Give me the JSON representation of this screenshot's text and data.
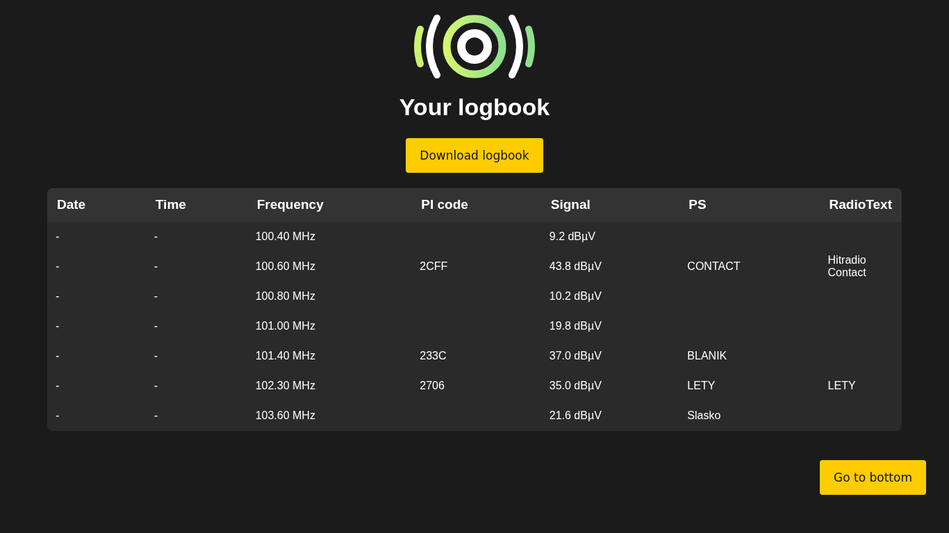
{
  "title": "Your logbook",
  "download_button": "Download logbook",
  "table": {
    "columns": [
      "Date",
      "Time",
      "Frequency",
      "PI code",
      "Signal",
      "PS",
      "RadioText"
    ],
    "rows": [
      [
        "-",
        "-",
        "100.40 MHz",
        null,
        "9.2 dBµV",
        null,
        null
      ],
      [
        "-",
        "-",
        "100.60 MHz",
        "2CFF",
        "43.8 dBµV",
        "CONTACT",
        "Hitradio Contact"
      ],
      [
        "-",
        "-",
        "100.80 MHz",
        null,
        "10.2 dBµV",
        null,
        null
      ],
      [
        "-",
        "-",
        "101.00 MHz",
        null,
        "19.8 dBµV",
        null,
        null
      ],
      [
        "-",
        "-",
        "101.40 MHz",
        "233C",
        "37.0 dBµV",
        "BLANIK",
        null
      ],
      [
        "-",
        "-",
        "102.30 MHz",
        "2706",
        "35.0 dBµV",
        "LETY",
        "LETY"
      ],
      [
        "-",
        "-",
        "103.60 MHz",
        null,
        "21.6 dBµV",
        "Slasko",
        null
      ]
    ]
  },
  "bottom_button": "Go to bottom"
}
